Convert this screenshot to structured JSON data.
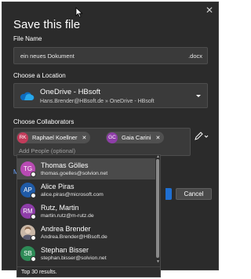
{
  "dialog": {
    "title": "Save this file",
    "close_glyph": "✕",
    "close_icon": "close-icon"
  },
  "file_name": {
    "label": "File Name",
    "value": "ein neues Dokument",
    "extension": ".docx"
  },
  "location": {
    "label": "Choose a Location",
    "name": "OneDrive - HBsoft",
    "path": "Hans.Brender@HBsoft.de » OneDrive - HBsoft",
    "icon": "onedrive-cloud-icon",
    "icon_color": "#0f6cbd"
  },
  "collaborators": {
    "label": "Choose Collaborators",
    "chips": [
      {
        "initials": "RK",
        "name": "Raphael Koellner",
        "color": "#c23b5a",
        "remove": "✕"
      },
      {
        "initials": "GC",
        "name": "Gaia Carini",
        "color": "#8e3da8",
        "remove": "✕"
      }
    ],
    "add_placeholder": "Add People (optional)",
    "edit_icon": "pencil-icon"
  },
  "side_truncated": "M",
  "cancel_label": "Cancel",
  "people": [
    {
      "initials": "TG",
      "name": "Thomas Gölles",
      "email": "thomas.goelles@solvion.net",
      "color": "#b84ab3",
      "selected": true
    },
    {
      "initials": "AP",
      "name": "Alice Piras",
      "email": "alice.piras@microsoft.com",
      "color": "#1f5aa6",
      "selected": false
    },
    {
      "initials": "RM",
      "name": "Rutz, Martin",
      "email": "martin.rutz@m-rutz.de",
      "color": "#8e3da8",
      "selected": false
    },
    {
      "initials": "",
      "name": "Andrea Brender",
      "email": "Andrea.Brender@HBsoft.de",
      "color": "#9b7f6a",
      "selected": false,
      "photo": true
    },
    {
      "initials": "SB",
      "name": "Stephan Bisser",
      "email": "stephan.bisser@solvion.net",
      "color": "#2e8b57",
      "selected": false
    }
  ],
  "results_text": "Top 30 results.",
  "presence_icon": "presence-dot-icon",
  "scroll_up_glyph": "▲",
  "scroll_down_glyph": "▼"
}
